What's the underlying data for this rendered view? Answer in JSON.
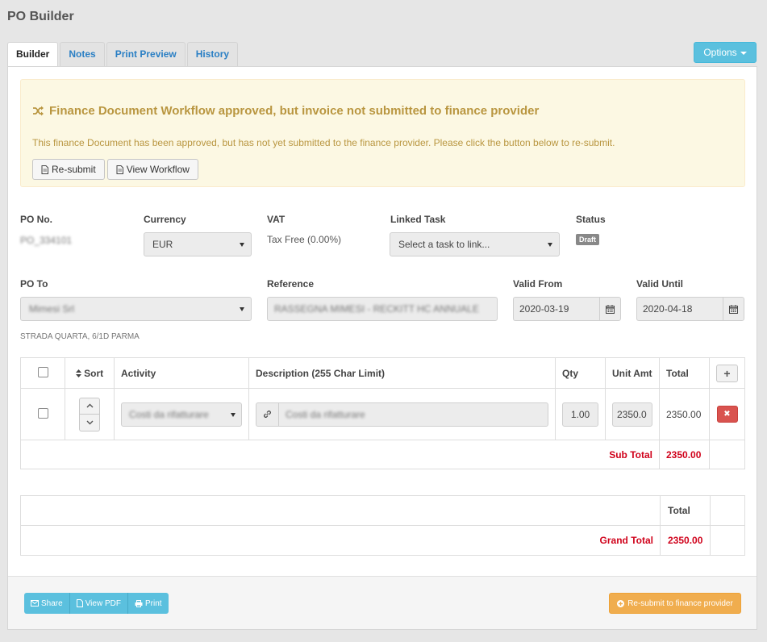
{
  "page": {
    "title": "PO Builder"
  },
  "tabs": [
    "Builder",
    "Notes",
    "Print Preview",
    "History"
  ],
  "options_button": "Options",
  "alert": {
    "title": "Finance Document Workflow approved, but invoice not submitted to finance provider",
    "text": "This finance Document has been approved, but has not yet submitted to the finance provider. Please click the button below to re-submit.",
    "resubmit_label": "Re-submit",
    "view_workflow_label": "View Workflow"
  },
  "form": {
    "po_no_label": "PO No.",
    "po_no_value": "PO_334101",
    "currency_label": "Currency",
    "currency_value": "EUR",
    "vat_label": "VAT",
    "vat_value": "Tax Free (0.00%)",
    "linked_task_label": "Linked Task",
    "linked_task_value": "Select a task to link...",
    "status_label": "Status",
    "status_value": "Draft",
    "po_to_label": "PO To",
    "po_to_value": "Mimesi Srl",
    "reference_label": "Reference",
    "reference_value": "RASSEGNA MIMESI - RECKITT HC ANNUALE",
    "valid_from_label": "Valid From",
    "valid_from_value": "2020-03-19",
    "valid_until_label": "Valid Until",
    "valid_until_value": "2020-04-18",
    "address": "STRADA QUARTA, 6/1D PARMA"
  },
  "items_table": {
    "headers": {
      "sort": "Sort",
      "activity": "Activity",
      "description": "Description (255 Char Limit)",
      "qty": "Qty",
      "unit_amt": "Unit Amt",
      "total": "Total",
      "add": "+"
    },
    "rows": [
      {
        "activity": "Costi da rifatturare",
        "description": "Costi da rifatturare",
        "qty": "1.00",
        "unit_amt": "2350.0",
        "total": "2350.00"
      }
    ],
    "subtotal_label": "Sub Total",
    "subtotal_value": "2350.00"
  },
  "totals_table": {
    "total_header": "Total",
    "grand_total_label": "Grand Total",
    "grand_total_value": "2350.00"
  },
  "footer": {
    "share_label": "Share",
    "view_pdf_label": "View PDF",
    "print_label": "Print",
    "resubmit_label": "Re-submit to finance provider"
  },
  "colors": {
    "accent": "#5bc0de",
    "warning": "#f0ad4e",
    "danger": "#d9534f",
    "alert_bg": "#fcf8e3",
    "alert_text": "#b99640",
    "total_red": "#d0021b"
  }
}
